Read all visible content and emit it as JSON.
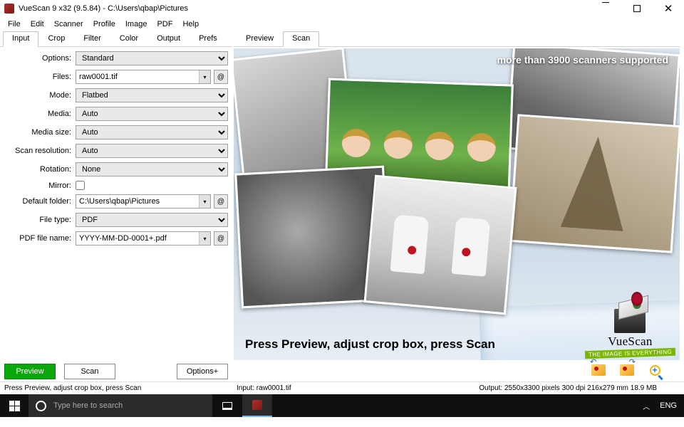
{
  "window": {
    "title": "VueScan 9 x32 (9.5.84) - C:\\Users\\qbap\\Pictures"
  },
  "menu": [
    "File",
    "Edit",
    "Scanner",
    "Profile",
    "Image",
    "PDF",
    "Help"
  ],
  "left_tabs": [
    "Input",
    "Crop",
    "Filter",
    "Color",
    "Output",
    "Prefs"
  ],
  "left_active_tab": 0,
  "right_tabs": [
    "Preview",
    "Scan"
  ],
  "right_active_tab": 1,
  "fields": {
    "options": {
      "label": "Options:",
      "value": "Standard"
    },
    "files": {
      "label": "Files:",
      "value": "raw0001.tif"
    },
    "mode": {
      "label": "Mode:",
      "value": "Flatbed"
    },
    "media": {
      "label": "Media:",
      "value": "Auto"
    },
    "media_size": {
      "label": "Media size:",
      "value": "Auto"
    },
    "scan_resolution": {
      "label": "Scan resolution:",
      "value": "Auto"
    },
    "rotation": {
      "label": "Rotation:",
      "value": "None"
    },
    "mirror": {
      "label": "Mirror:",
      "checked": false
    },
    "default_folder": {
      "label": "Default folder:",
      "value": "C:\\Users\\qbap\\Pictures"
    },
    "file_type": {
      "label": "File type:",
      "value": "PDF"
    },
    "pdf_file_name": {
      "label": "PDF file name:",
      "value": "YYYY-MM-DD-0001+.pdf"
    }
  },
  "banner_text": "more than 3900 scanners supported",
  "hint_text": "Press Preview, adjust crop box, press Scan",
  "brand": {
    "name": "VueScan",
    "strapline": "THE IMAGE IS EVERYTHING"
  },
  "buttons": {
    "preview": "Preview",
    "scan": "Scan",
    "options": "Options+"
  },
  "statusbar": {
    "left": "Press Preview, adjust crop box, press Scan",
    "center": "Input: raw0001.tif",
    "right": "Output: 2550x3300 pixels 300 dpi 216x279 mm 18.9 MB"
  },
  "taskbar": {
    "search_placeholder": "Type here to search",
    "lang": "ENG"
  },
  "at_glyph": "@"
}
